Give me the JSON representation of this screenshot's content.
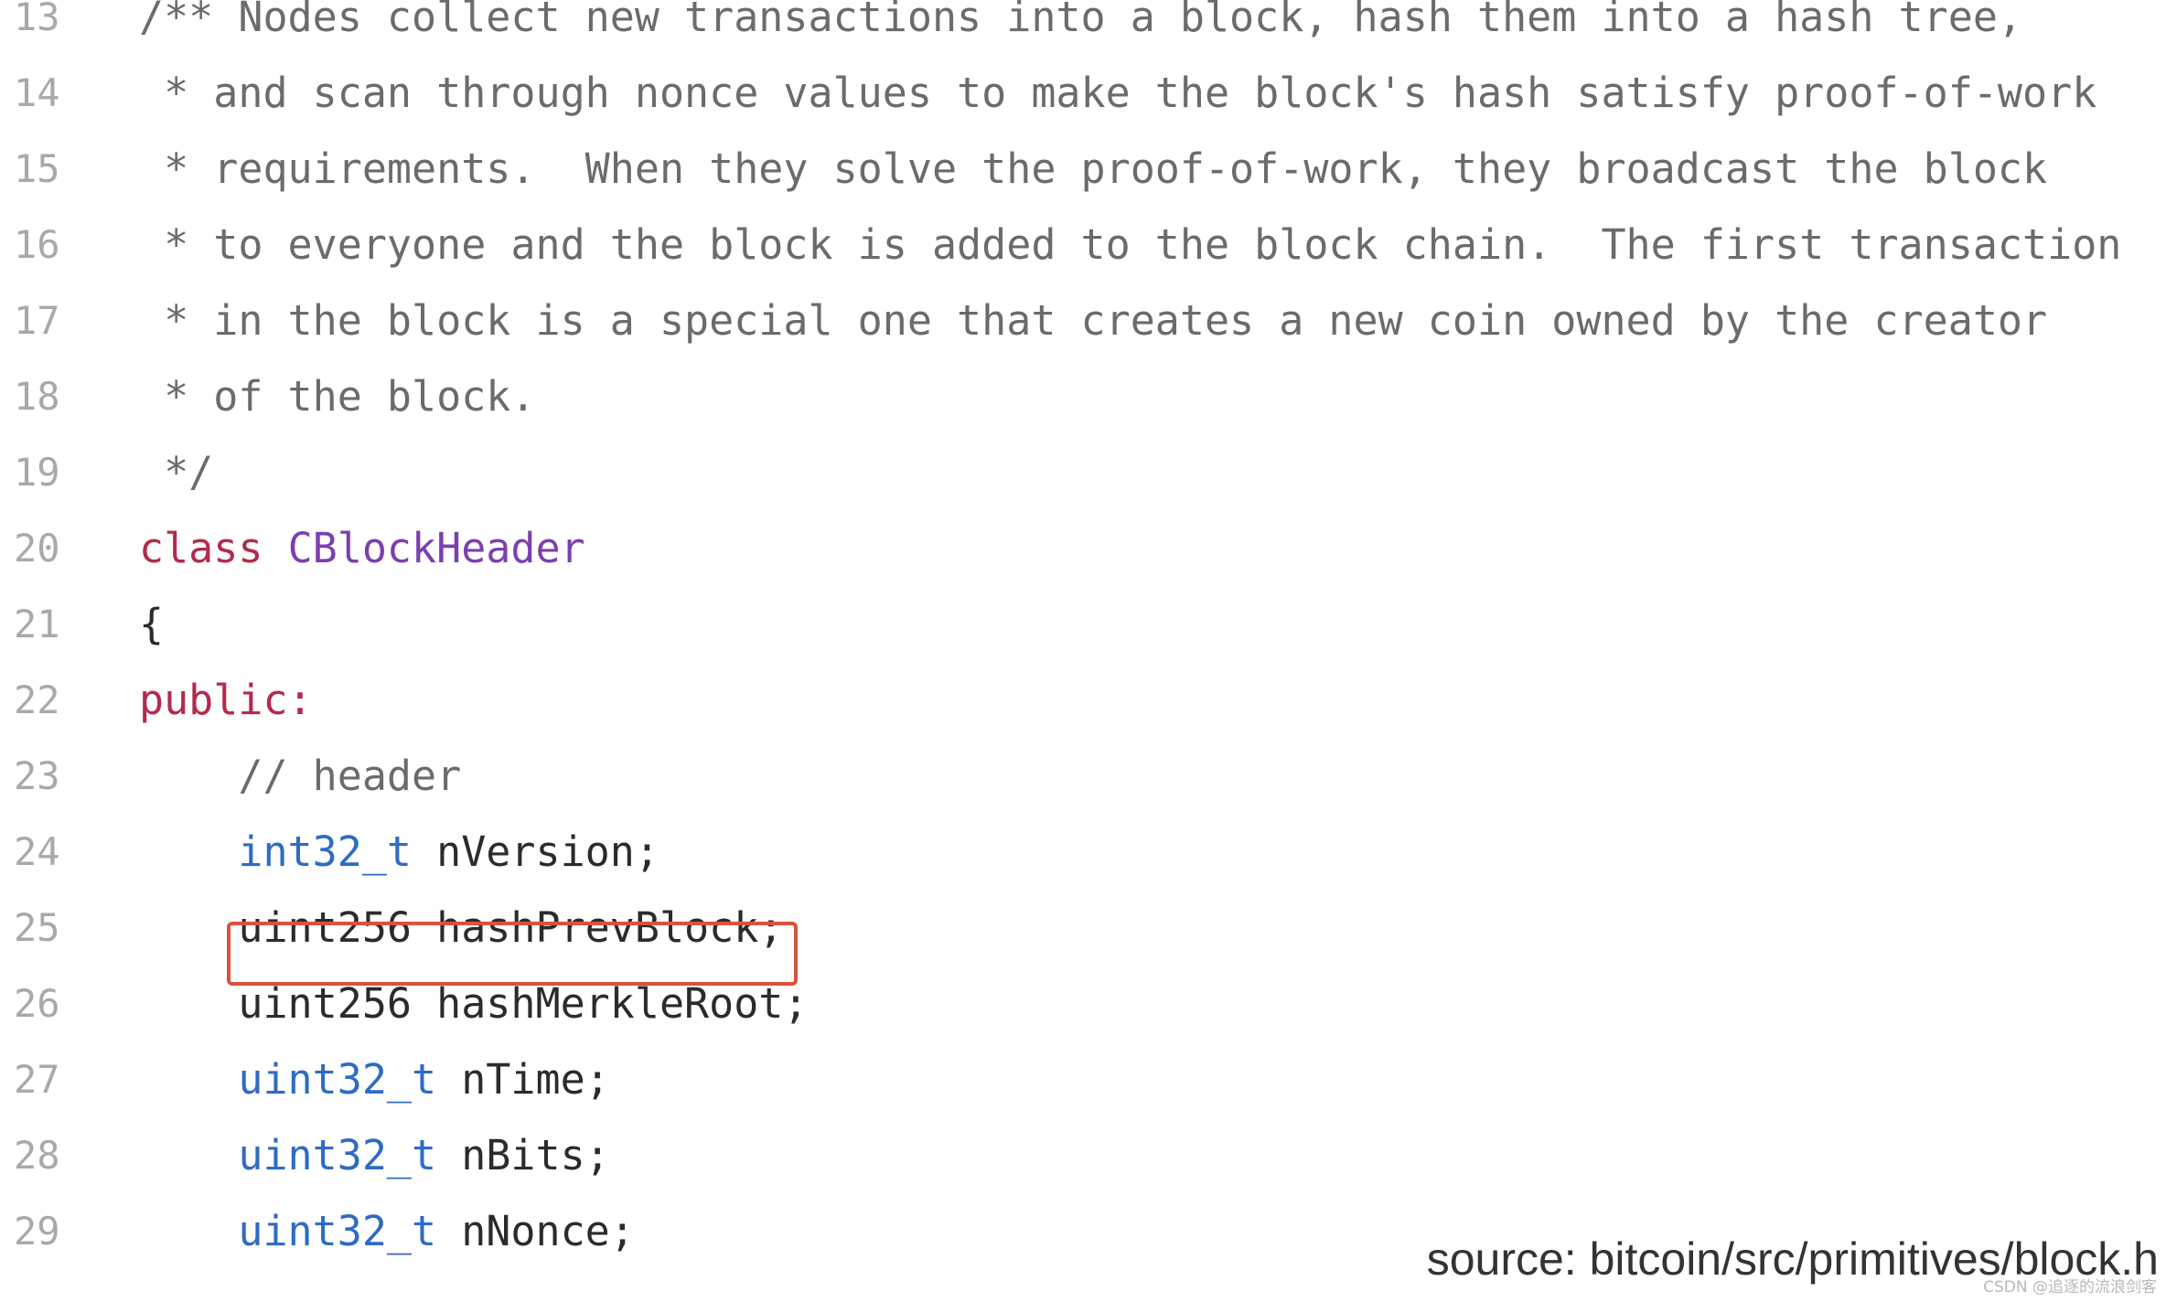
{
  "lines": [
    {
      "n": "13",
      "tokens": [
        {
          "t": "/** Nodes collect new transactions into a block, hash them into a hash tree,",
          "c": "comment"
        }
      ]
    },
    {
      "n": "14",
      "tokens": [
        {
          "t": " * and scan through nonce values to make the block's hash satisfy proof-of-work",
          "c": "comment"
        }
      ]
    },
    {
      "n": "15",
      "tokens": [
        {
          "t": " * requirements.  When they solve the proof-of-work, they broadcast the block",
          "c": "comment"
        }
      ]
    },
    {
      "n": "16",
      "tokens": [
        {
          "t": " * to everyone and the block is added to the block chain.  The first transaction",
          "c": "comment"
        }
      ]
    },
    {
      "n": "17",
      "tokens": [
        {
          "t": " * in the block is a special one that creates a new coin owned by the creator",
          "c": "comment"
        }
      ]
    },
    {
      "n": "18",
      "tokens": [
        {
          "t": " * of the block.",
          "c": "comment"
        }
      ]
    },
    {
      "n": "19",
      "tokens": [
        {
          "t": " */",
          "c": "comment"
        }
      ]
    },
    {
      "n": "20",
      "tokens": [
        {
          "t": "class",
          "c": "keyword"
        },
        {
          "t": " ",
          "c": "plain"
        },
        {
          "t": "CBlockHeader",
          "c": "classname"
        }
      ]
    },
    {
      "n": "21",
      "tokens": [
        {
          "t": "{",
          "c": "plain"
        }
      ]
    },
    {
      "n": "22",
      "tokens": [
        {
          "t": "public:",
          "c": "keyword"
        }
      ]
    },
    {
      "n": "23",
      "tokens": [
        {
          "t": "    // header",
          "c": "comment"
        }
      ]
    },
    {
      "n": "24",
      "tokens": [
        {
          "t": "    ",
          "c": "plain"
        },
        {
          "t": "int32_t",
          "c": "type"
        },
        {
          "t": " nVersion;",
          "c": "plain"
        }
      ]
    },
    {
      "n": "25",
      "tokens": [
        {
          "t": "    uint256 hashPrevBlock;",
          "c": "plain"
        }
      ]
    },
    {
      "n": "26",
      "tokens": [
        {
          "t": "    uint256 hashMerkleRoot;",
          "c": "plain"
        }
      ]
    },
    {
      "n": "27",
      "tokens": [
        {
          "t": "    ",
          "c": "plain"
        },
        {
          "t": "uint32_t",
          "c": "type"
        },
        {
          "t": " nTime;",
          "c": "plain"
        }
      ]
    },
    {
      "n": "28",
      "tokens": [
        {
          "t": "    ",
          "c": "plain"
        },
        {
          "t": "uint32_t",
          "c": "type"
        },
        {
          "t": " nBits;",
          "c": "plain"
        }
      ]
    },
    {
      "n": "29",
      "tokens": [
        {
          "t": "    ",
          "c": "plain"
        },
        {
          "t": "uint32_t",
          "c": "type"
        },
        {
          "t": " nNonce;",
          "c": "plain"
        }
      ]
    }
  ],
  "highlighted_line": "25",
  "caption": "source: bitcoin/src/primitives/block.h",
  "watermark": "CSDN @追逐的流浪剑客",
  "colors": {
    "line_number": "#a9a9a9",
    "comment": "#6b6b6b",
    "keyword": "#b42a4a",
    "classname": "#7b3fb0",
    "type": "#2f6bc4",
    "plain": "#2b2b2b",
    "highlight_border": "#d9533a"
  }
}
